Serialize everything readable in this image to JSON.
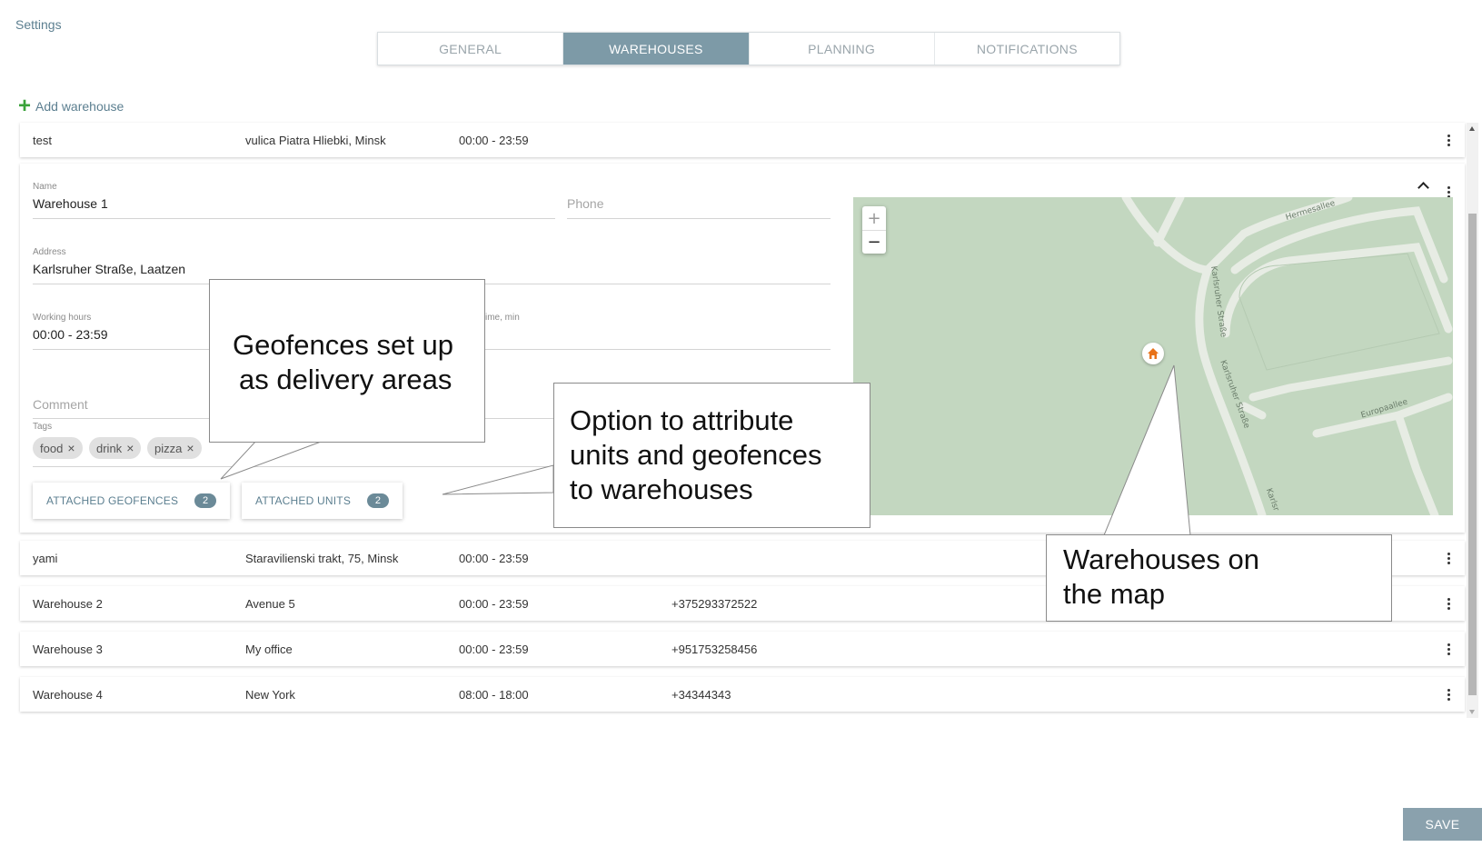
{
  "page": {
    "title": "Settings"
  },
  "tabs": [
    {
      "label": "GENERAL"
    },
    {
      "label": "WAREHOUSES"
    },
    {
      "label": "PLANNING"
    },
    {
      "label": "NOTIFICATIONS"
    }
  ],
  "active_tab": "WAREHOUSES",
  "add_warehouse_label": "Add warehouse",
  "rows": {
    "test": {
      "name": "test",
      "address": "vulica Piatra Hliebki, Minsk",
      "hours": "00:00 - 23:59",
      "phone": ""
    },
    "yami": {
      "name": "yami",
      "address": "Staravilienski trakt, 75, Minsk",
      "hours": "00:00 - 23:59",
      "phone": ""
    },
    "wh2": {
      "name": "Warehouse 2",
      "address": "Avenue 5",
      "hours": "00:00 - 23:59",
      "phone": "+375293372522"
    },
    "wh3": {
      "name": "Warehouse 3",
      "address": "My office",
      "hours": "00:00 - 23:59",
      "phone": "+951753258456"
    },
    "wh4": {
      "name": "Warehouse 4",
      "address": "New York",
      "hours": "08:00 - 18:00",
      "phone": "+34344343"
    }
  },
  "editor": {
    "name_label": "Name",
    "name_value": "Warehouse 1",
    "phone_placeholder": "Phone",
    "address_label": "Address",
    "address_value": "Karlsruher Straße, Laatzen",
    "hours_label": "Working hours",
    "hours_value": "00:00 - 23:59",
    "service_time_label_fragment": "ime, min",
    "comment_placeholder": "Comment",
    "tags_label": "Tags",
    "tags": [
      "food",
      "drink",
      "pizza"
    ],
    "attached_geofences_label": "ATTACHED GEOFENCES",
    "attached_geofences_count": "2",
    "attached_units_label": "ATTACHED UNITS",
    "attached_units_count": "2"
  },
  "map": {
    "zoom_in": "+",
    "zoom_out": "−",
    "streets": [
      "Hermesallee",
      "Karlsruher Straße",
      "Karlsruher Straße",
      "Europaallee",
      "Karlsr"
    ]
  },
  "callouts": {
    "geofences_l1": "Geofences set up",
    "geofences_l2": "as delivery areas",
    "attribute_l1": "Option to attribute",
    "attribute_l2": "units and geofences",
    "attribute_l3": "to warehouses",
    "map_l1": "Warehouses on",
    "map_l2": "the map"
  },
  "save_label": "SAVE",
  "colors": {
    "accent": "#7d9aa7",
    "link": "#5c7f90",
    "add_icon": "#3aa23a",
    "map_bg": "#c3d7c0",
    "pin": "#e8731a"
  },
  "icons": [
    "plus-icon",
    "kebab-icon",
    "chevron-up-icon",
    "close-icon",
    "home-pin-icon"
  ]
}
